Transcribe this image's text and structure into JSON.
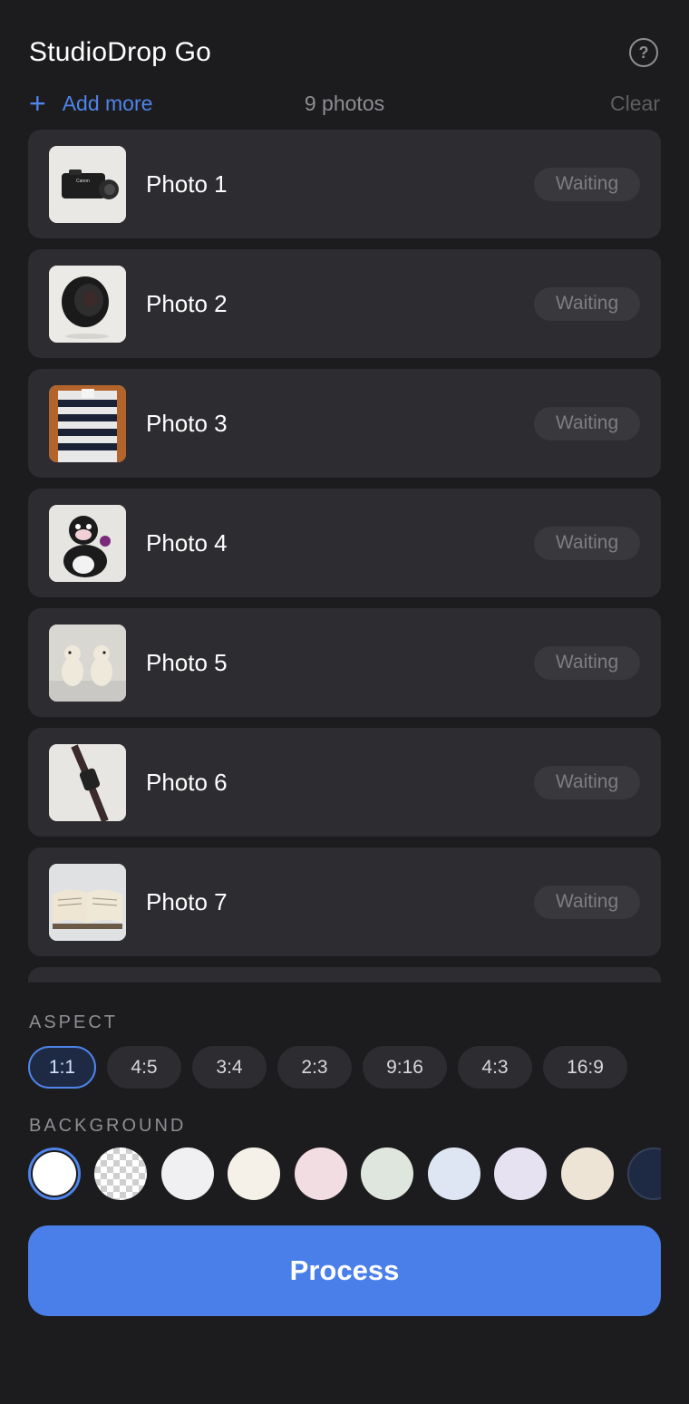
{
  "app": {
    "title": "StudioDrop Go"
  },
  "header": {
    "help_icon": "question-circle-icon",
    "help_glyph": "?"
  },
  "toolbar": {
    "add_icon": "plus-icon",
    "add_glyph": "+",
    "add_label": "Add more",
    "count_label": "9 photos",
    "clear_label": "Clear"
  },
  "photos": [
    {
      "name": "Photo 1",
      "status": "Waiting",
      "thumbnail": "camera"
    },
    {
      "name": "Photo 2",
      "status": "Waiting",
      "thumbnail": "lens"
    },
    {
      "name": "Photo 3",
      "status": "Waiting",
      "thumbnail": "striped-shirt"
    },
    {
      "name": "Photo 4",
      "status": "Waiting",
      "thumbnail": "plush-toy"
    },
    {
      "name": "Photo 5",
      "status": "Waiting",
      "thumbnail": "ceramic-dogs"
    },
    {
      "name": "Photo 6",
      "status": "Waiting",
      "thumbnail": "watch"
    },
    {
      "name": "Photo 7",
      "status": "Waiting",
      "thumbnail": "open-book"
    },
    {
      "name": "",
      "status": "",
      "thumbnail": ""
    }
  ],
  "aspect": {
    "label": "ASPECT",
    "selected": "1:1",
    "options": [
      "1:1",
      "4:5",
      "3:4",
      "2:3",
      "9:16",
      "4:3",
      "16:9"
    ]
  },
  "background": {
    "label": "BACKGROUND",
    "selected_index": 0,
    "swatches": [
      "#ffffff",
      "transparent",
      "#f0f0f2",
      "#f6f1e8",
      "#f2dde3",
      "#dfe6dd",
      "#dde6f2",
      "#e6e2f2",
      "#ede4d6",
      "#1e2a44"
    ]
  },
  "actions": {
    "process_label": "Process"
  },
  "colors": {
    "accent": "#4a7fea",
    "background": "#1c1c1e",
    "card": "#2c2c31"
  }
}
